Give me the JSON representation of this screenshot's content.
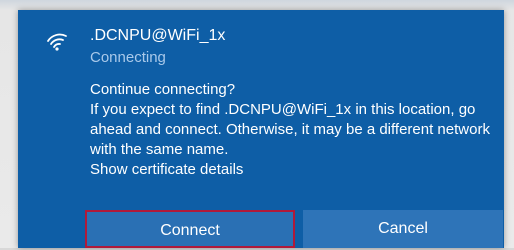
{
  "network": {
    "ssid": ".DCNPU@WiFi_1x",
    "status": "Connecting",
    "icon": "wifi-signal-icon"
  },
  "prompt": {
    "question": "Continue connecting?",
    "body": "If you expect to find .DCNPU@WiFi_1x in this location, go ahead and connect. Otherwise, it may be a different network with the same name.",
    "cert_link": "Show certificate details"
  },
  "buttons": {
    "connect": "Connect",
    "cancel": "Cancel"
  },
  "colors": {
    "panel_bg": "#0e5ea6",
    "button_bg": "#2e74b8",
    "focus_border": "#b01a3a",
    "status_text": "#a9c9ea"
  }
}
